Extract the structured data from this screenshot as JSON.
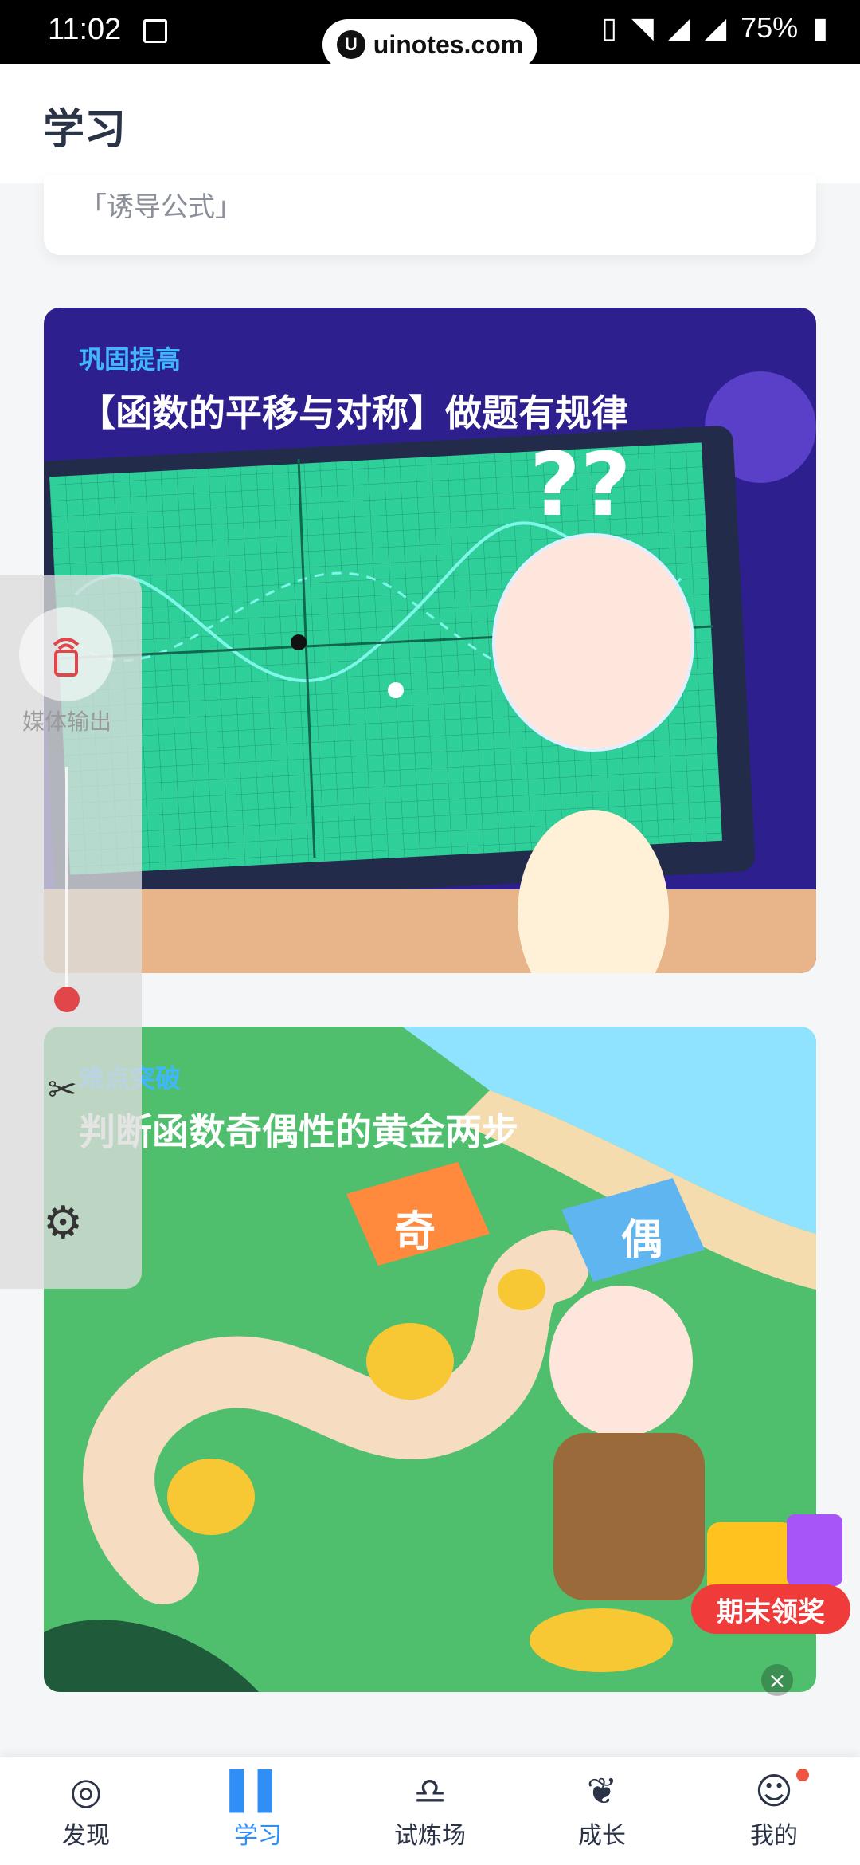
{
  "status_bar": {
    "time": "11:02",
    "url": "uinotes.com",
    "battery": "75%"
  },
  "header": {
    "title": "学习"
  },
  "prev_card": {
    "text": "「诱导公式」"
  },
  "cards": [
    {
      "tag": "巩固提高",
      "title": "【函数的平移与对称】做题有规律"
    },
    {
      "tag": "难点突破",
      "title": "判断函数奇偶性的黄金两步"
    }
  ],
  "side_panel": {
    "cast_label": "媒体输出",
    "cast_icon": "cast-icon",
    "cut_icon": "scissors-icon",
    "gear_icon": "gear-icon"
  },
  "promo": {
    "label": "期末领奖"
  },
  "bottom_nav": {
    "items": [
      {
        "label": "发现",
        "icon": "compass-icon"
      },
      {
        "label": "学习",
        "icon": "book-icon"
      },
      {
        "label": "试炼场",
        "icon": "bell-icon"
      },
      {
        "label": "成长",
        "icon": "leaf-icon"
      },
      {
        "label": "我的",
        "icon": "profile-icon"
      }
    ],
    "active_index": 1
  },
  "colors": {
    "accent": "#2f8ff7",
    "text_dark": "#2b3347",
    "tag_blue": "#3fb7ff",
    "promo_red": "#f03b3b"
  }
}
